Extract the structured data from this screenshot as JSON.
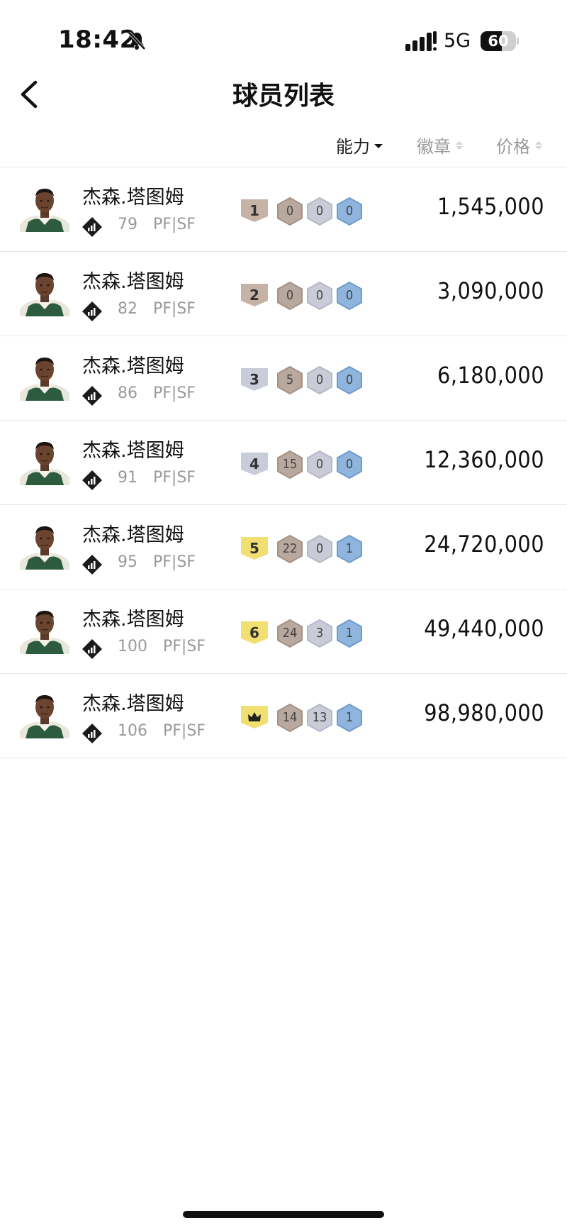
{
  "status_bar": {
    "time": "18:42",
    "network": "5G",
    "battery": "60",
    "battery_level": 0.6
  },
  "header": {
    "title": "球员列表",
    "back_icon": "chevron-left-icon"
  },
  "sort_bar": {
    "ability": "能力",
    "badge": "徽章",
    "price": "价格",
    "active": "ability"
  },
  "colors": {
    "tier_gray": "#c8ccd8",
    "tier_bronze": "#c7b3a6",
    "tier_gold": "#f2df72",
    "hex_bronze": "#b8a89d",
    "hex_silver": "#c9cbd6",
    "hex_blue": "#8fb4dd"
  },
  "players": [
    {
      "name": "杰森.塔图姆",
      "rating": "79",
      "position": "PF|SF",
      "tier": "1",
      "tier_color": "#c7b3a6",
      "badges": [
        "0",
        "0",
        "0"
      ],
      "price": "1,545,000"
    },
    {
      "name": "杰森.塔图姆",
      "rating": "82",
      "position": "PF|SF",
      "tier": "2",
      "tier_color": "#c7b3a6",
      "badges": [
        "0",
        "0",
        "0"
      ],
      "price": "3,090,000"
    },
    {
      "name": "杰森.塔图姆",
      "rating": "86",
      "position": "PF|SF",
      "tier": "3",
      "tier_color": "#c9cdd9",
      "badges": [
        "5",
        "0",
        "0"
      ],
      "price": "6,180,000"
    },
    {
      "name": "杰森.塔图姆",
      "rating": "91",
      "position": "PF|SF",
      "tier": "4",
      "tier_color": "#c9cdd9",
      "badges": [
        "15",
        "0",
        "0"
      ],
      "price": "12,360,000"
    },
    {
      "name": "杰森.塔图姆",
      "rating": "95",
      "position": "PF|SF",
      "tier": "5",
      "tier_color": "#f2df72",
      "badges": [
        "22",
        "0",
        "1"
      ],
      "price": "24,720,000"
    },
    {
      "name": "杰森.塔图姆",
      "rating": "100",
      "position": "PF|SF",
      "tier": "6",
      "tier_color": "#f2df72",
      "badges": [
        "24",
        "3",
        "1"
      ],
      "price": "49,440,000"
    },
    {
      "name": "杰森.塔图姆",
      "rating": "106",
      "position": "PF|SF",
      "tier": "",
      "tier_icon": "crown-icon",
      "tier_color": "#f2df72",
      "badges": [
        "14",
        "13",
        "1"
      ],
      "price": "98,980,000"
    }
  ]
}
